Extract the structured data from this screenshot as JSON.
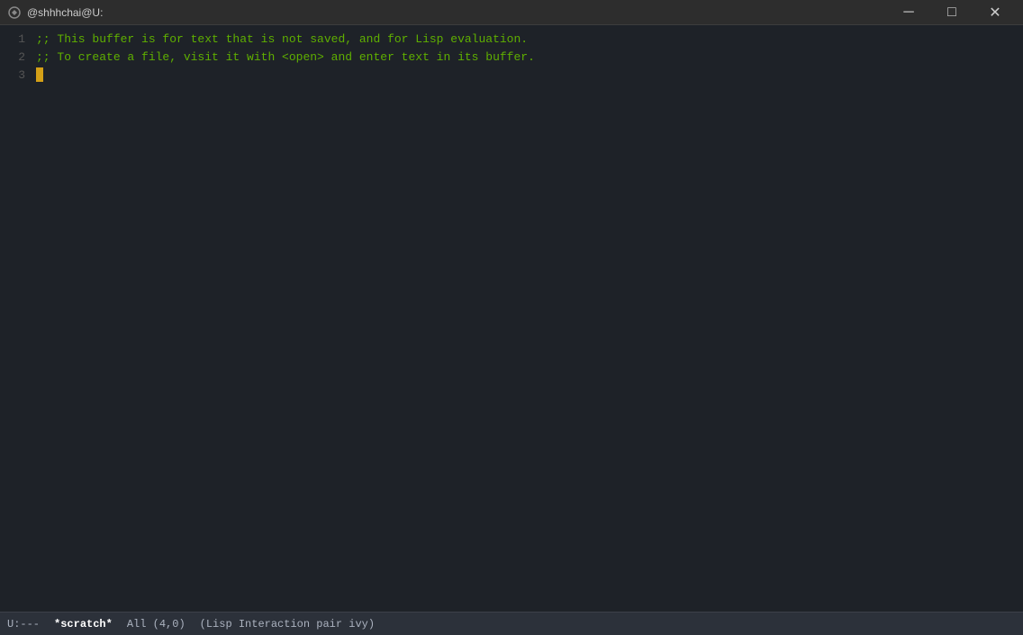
{
  "titlebar": {
    "title": "@shhhchai@U:",
    "minimize_label": "─",
    "maximize_label": "□",
    "close_label": "✕"
  },
  "editor": {
    "lines": [
      {
        "number": "1",
        "content": ";; This buffer is for text that is not saved, and for Lisp evaluation."
      },
      {
        "number": "2",
        "content": ";; To create a file, visit it with <open> and enter text in its buffer."
      },
      {
        "number": "3",
        "content": ""
      }
    ]
  },
  "statusbar": {
    "mode": "U:---",
    "buffer_name": "*scratch*",
    "position": "All (4,0)",
    "major_mode": "(Lisp Interaction pair ivy)"
  }
}
